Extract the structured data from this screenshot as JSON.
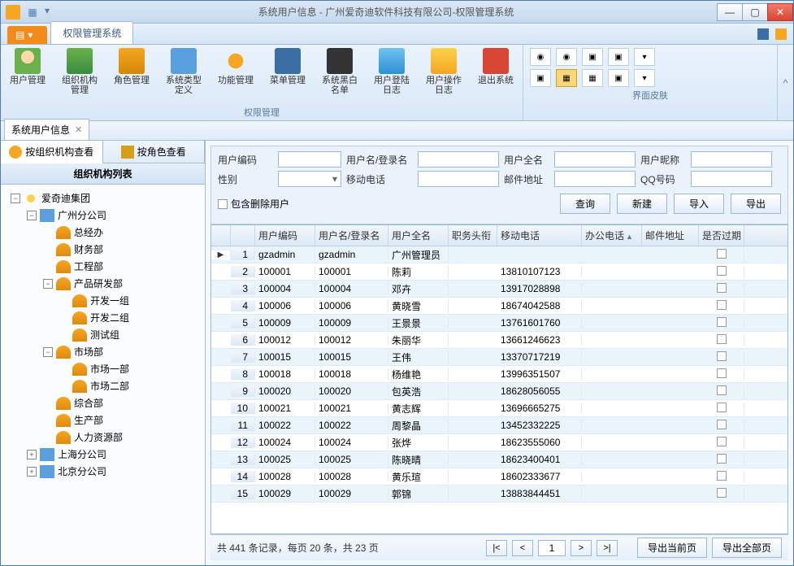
{
  "window": {
    "title": "系统用户信息 - 广州爱奇迪软件科技有限公司-权限管理系统"
  },
  "menu": {
    "primary": "权限管理系统"
  },
  "ribbon": {
    "group1_title": "权限管理",
    "items": [
      {
        "label": "用户管理"
      },
      {
        "label": "组织机构管理"
      },
      {
        "label": "角色管理"
      },
      {
        "label": "系统类型定义"
      },
      {
        "label": "功能管理"
      },
      {
        "label": "菜单管理"
      },
      {
        "label": "系统黑白名单"
      },
      {
        "label": "用户登陆日志"
      },
      {
        "label": "用户操作日志"
      },
      {
        "label": "退出系统"
      }
    ],
    "group2_title": "界面皮肤"
  },
  "doc_tab": {
    "title": "系统用户信息"
  },
  "left": {
    "tab_org": "按组织机构查看",
    "tab_role": "按角色查看",
    "tree_title": "组织机构列表",
    "tree": [
      {
        "depth": 0,
        "toggle": "−",
        "iconClass": "ti-sun",
        "text": "爱奇迪集团"
      },
      {
        "depth": 1,
        "toggle": "−",
        "iconClass": "ti-bldg",
        "text": "广州分公司"
      },
      {
        "depth": 2,
        "toggle": "",
        "iconClass": "ti-grp",
        "text": "总经办"
      },
      {
        "depth": 2,
        "toggle": "",
        "iconClass": "ti-grp",
        "text": "财务部"
      },
      {
        "depth": 2,
        "toggle": "",
        "iconClass": "ti-grp",
        "text": "工程部"
      },
      {
        "depth": 2,
        "toggle": "−",
        "iconClass": "ti-grp",
        "text": "产品研发部"
      },
      {
        "depth": 3,
        "toggle": "",
        "iconClass": "ti-grp",
        "text": "开发一组"
      },
      {
        "depth": 3,
        "toggle": "",
        "iconClass": "ti-grp",
        "text": "开发二组"
      },
      {
        "depth": 3,
        "toggle": "",
        "iconClass": "ti-grp",
        "text": "测试组"
      },
      {
        "depth": 2,
        "toggle": "−",
        "iconClass": "ti-grp",
        "text": "市场部"
      },
      {
        "depth": 3,
        "toggle": "",
        "iconClass": "ti-grp",
        "text": "市场一部"
      },
      {
        "depth": 3,
        "toggle": "",
        "iconClass": "ti-grp",
        "text": "市场二部"
      },
      {
        "depth": 2,
        "toggle": "",
        "iconClass": "ti-grp",
        "text": "综合部"
      },
      {
        "depth": 2,
        "toggle": "",
        "iconClass": "ti-grp",
        "text": "生产部"
      },
      {
        "depth": 2,
        "toggle": "",
        "iconClass": "ti-grp",
        "text": "人力资源部"
      },
      {
        "depth": 1,
        "toggle": "+",
        "iconClass": "ti-bldg",
        "text": "上海分公司"
      },
      {
        "depth": 1,
        "toggle": "+",
        "iconClass": "ti-bldg",
        "text": "北京分公司"
      }
    ]
  },
  "form": {
    "labels": {
      "code": "用户编码",
      "username": "用户名/登录名",
      "fullname": "用户全名",
      "nickname": "用户昵称",
      "gender": "性别",
      "mobile": "移动电话",
      "email": "邮件地址",
      "qq": "QQ号码"
    },
    "include_deleted": "包含删除用户",
    "buttons": {
      "query": "查询",
      "new": "新建",
      "import": "导入",
      "export": "导出"
    }
  },
  "grid": {
    "headers": {
      "code": "用户编码",
      "user": "用户名/登录名",
      "name": "用户全名",
      "title": "职务头衔",
      "mobile": "移动电话",
      "office": "办公电话",
      "email": "邮件地址",
      "expired": "是否过期"
    },
    "rows": [
      {
        "n": 1,
        "code": "gzadmin",
        "user": "gzadmin",
        "name": "广州管理员",
        "mobile": ""
      },
      {
        "n": 2,
        "code": "100001",
        "user": "100001",
        "name": "陈莉",
        "mobile": "13810107123"
      },
      {
        "n": 3,
        "code": "100004",
        "user": "100004",
        "name": "邓卉",
        "mobile": "13917028898"
      },
      {
        "n": 4,
        "code": "100006",
        "user": "100006",
        "name": "黄晓雪",
        "mobile": "18674042588"
      },
      {
        "n": 5,
        "code": "100009",
        "user": "100009",
        "name": "王景景",
        "mobile": "13761601760"
      },
      {
        "n": 6,
        "code": "100012",
        "user": "100012",
        "name": "朱丽华",
        "mobile": "13661246623"
      },
      {
        "n": 7,
        "code": "100015",
        "user": "100015",
        "name": "王伟",
        "mobile": "13370717219"
      },
      {
        "n": 8,
        "code": "100018",
        "user": "100018",
        "name": "杨维艳",
        "mobile": "13996351507"
      },
      {
        "n": 9,
        "code": "100020",
        "user": "100020",
        "name": "包英浩",
        "mobile": "18628056055"
      },
      {
        "n": 10,
        "code": "100021",
        "user": "100021",
        "name": "黄志辉",
        "mobile": "13696665275"
      },
      {
        "n": 11,
        "code": "100022",
        "user": "100022",
        "name": "周黎晶",
        "mobile": "13452332225"
      },
      {
        "n": 12,
        "code": "100024",
        "user": "100024",
        "name": "张烨",
        "mobile": "18623555060"
      },
      {
        "n": 13,
        "code": "100025",
        "user": "100025",
        "name": "陈晓晴",
        "mobile": "18623400401"
      },
      {
        "n": 14,
        "code": "100028",
        "user": "100028",
        "name": "黄乐瑄",
        "mobile": "18602333677"
      },
      {
        "n": 15,
        "code": "100029",
        "user": "100029",
        "name": "郭锦",
        "mobile": "13883844451"
      }
    ]
  },
  "pager": {
    "info": "共 441 条记录，每页 20 条，共 23 页",
    "first": "|<",
    "prev": "<",
    "page": "1",
    "next": ">",
    "last": ">|",
    "export_current": "导出当前页",
    "export_all": "导出全部页"
  }
}
